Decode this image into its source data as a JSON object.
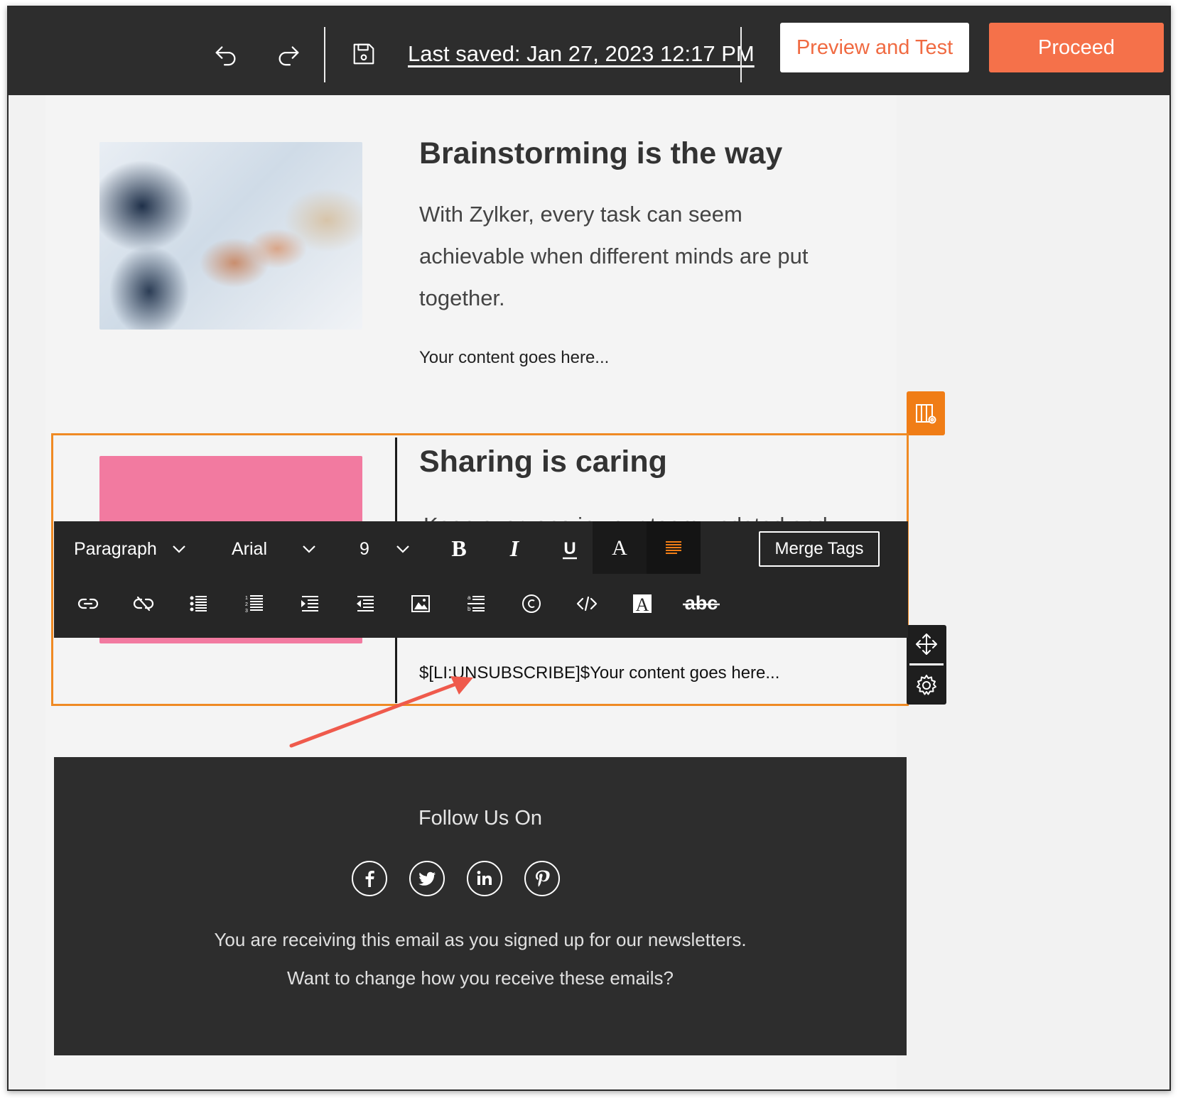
{
  "topbar": {
    "undo_icon": "undo-icon",
    "redo_icon": "redo-icon",
    "save_icon": "floppy-save-icon",
    "last_saved": "Last saved: Jan 27, 2023 12:17 PM",
    "preview_label": "Preview and Test",
    "proceed_label": "Proceed",
    "accent_color": "#f5714a"
  },
  "section1": {
    "heading": "Brainstorming is the way",
    "paragraph": "With Zylker, every task can seem achievable when different minds are put together.",
    "content": "Your content goes here..."
  },
  "section2": {
    "heading": "Sharing is caring",
    "paragraph_partial": "Keep everyone in your team updated and",
    "content": "$[LI:UNSUBSCRIBE]$Your content goes here..."
  },
  "toolbar": {
    "format": "Paragraph",
    "font": "Arial",
    "size": "9",
    "merge_tags_label": "Merge Tags",
    "highlight_color": "#f07d16"
  },
  "footer": {
    "follow": "Follow Us On",
    "social": [
      "facebook-icon",
      "twitter-icon",
      "linkedin-icon",
      "pinterest-icon"
    ],
    "note1": "You are receiving this email as you signed up for our newsletters.",
    "note2": "Want to change how you receive these emails?"
  }
}
